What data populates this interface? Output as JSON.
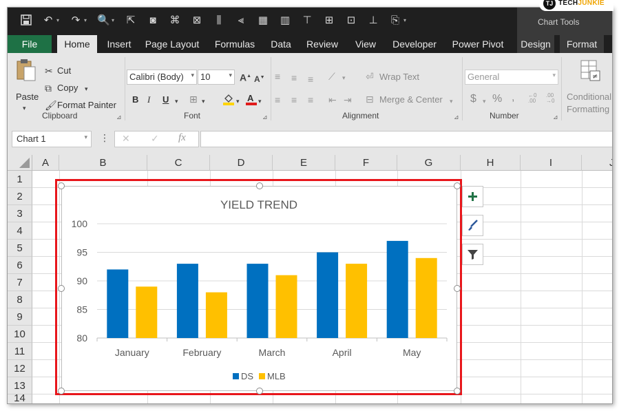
{
  "app": {
    "context_title": "Chart Tools",
    "logo": {
      "prefix": "TECH",
      "suffix": "JUNKIE",
      "badge": "TJ"
    }
  },
  "tabs": [
    "File",
    "Home",
    "Insert",
    "Page Layout",
    "Formulas",
    "Data",
    "Review",
    "View",
    "Developer",
    "Power Pivot",
    "Design",
    "Format"
  ],
  "ribbon": {
    "clipboard": {
      "paste": "Paste",
      "cut": "Cut",
      "copy": "Copy",
      "format_painter": "Format Painter",
      "label": "Clipboard"
    },
    "font": {
      "name": "Calibri (Body)",
      "size": "10",
      "bold": "B",
      "italic": "I",
      "underline": "U",
      "label": "Font"
    },
    "alignment": {
      "wrap_text": "Wrap Text",
      "merge_center": "Merge & Center",
      "label": "Alignment"
    },
    "number": {
      "format": "General",
      "currency": "$",
      "percent": "%",
      "comma": ",",
      "label": "Number"
    },
    "styles": {
      "conditional": "Conditional",
      "formatting": "Formatting"
    }
  },
  "formula_bar": {
    "name_box": "Chart 1",
    "fx": "fx",
    "formula": ""
  },
  "grid": {
    "columns": [
      "A",
      "B",
      "C",
      "D",
      "E",
      "F",
      "G",
      "H",
      "I",
      "J"
    ],
    "rows": [
      "1",
      "2",
      "3",
      "4",
      "5",
      "6",
      "7",
      "8",
      "9",
      "10",
      "11",
      "12",
      "13",
      "14"
    ]
  },
  "chart_data": {
    "type": "bar",
    "title": "YIELD TREND",
    "categories": [
      "January",
      "February",
      "March",
      "April",
      "May"
    ],
    "series": [
      {
        "name": "DS",
        "color": "#0070c0",
        "values": [
          92,
          93,
          93,
          95,
          97
        ]
      },
      {
        "name": "MLB",
        "color": "#ffc000",
        "values": [
          89,
          88,
          91,
          93,
          94
        ]
      }
    ],
    "ylim": [
      80,
      100
    ],
    "yticks": [
      "80",
      "85",
      "90",
      "95",
      "100"
    ],
    "grid": true,
    "legend": "bottom"
  }
}
